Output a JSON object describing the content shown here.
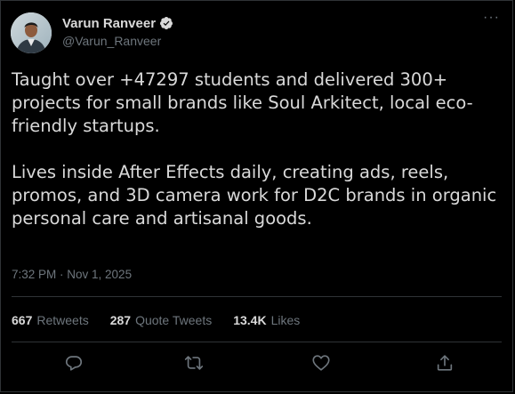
{
  "author": {
    "display_name": "Varun Ranveer",
    "handle": "@Varun_Ranveer"
  },
  "menu": {
    "more_label": "···"
  },
  "tweet": {
    "paragraph_1": "Taught over +47297 students and delivered 300+ projects for small brands like Soul Arkitect, local eco-friendly startups.",
    "paragraph_2": "Lives inside After Effects daily, creating ads, reels, promos, and 3D camera work for D2C brands in organic personal care and artisanal goods.",
    "timestamp": "7:32 PM · Nov 1, 2025"
  },
  "stats": {
    "retweets_count": "667",
    "retweets_label": "Retweets",
    "quote_count": "287",
    "quote_label": "Quote Tweets",
    "likes_count": "13.4K",
    "likes_label": "Likes"
  },
  "actions": {
    "icons": [
      "reply-icon",
      "retweet-icon",
      "like-icon",
      "share-icon"
    ]
  },
  "colors": {
    "background": "#000000",
    "text": "#d9d9d9",
    "muted": "#6e767d",
    "divider": "#2f3336"
  }
}
